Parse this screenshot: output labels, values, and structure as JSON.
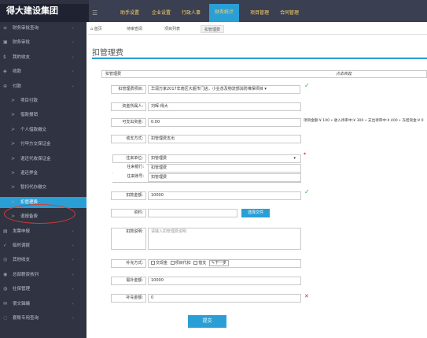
{
  "brand": "得大建设集团",
  "topnav": [
    "助手设置",
    "企业设置",
    "行政人事",
    "财务统计",
    "项目管理",
    "合同管理"
  ],
  "sidebar": [
    {
      "icon": "≡",
      "label": "财务审批查询"
    },
    {
      "icon": "▣",
      "label": "财务审批"
    },
    {
      "icon": "$",
      "label": "我的收支"
    },
    {
      "icon": "◈",
      "label": "收款"
    },
    {
      "icon": "⊕",
      "label": "付款"
    },
    {
      "icon": ">",
      "label": "项目付款",
      "sub": true
    },
    {
      "icon": ">",
      "label": "借款报销",
      "sub": true
    },
    {
      "icon": ">",
      "label": "个人借款缴交",
      "sub": true
    },
    {
      "icon": ">",
      "label": "付甲方交保证金",
      "sub": true
    },
    {
      "icon": ">",
      "label": "退还代收保证金",
      "sub": true
    },
    {
      "icon": ">",
      "label": "退还押金",
      "sub": true
    },
    {
      "icon": ">",
      "label": "暂扣代办缴交",
      "sub": true
    },
    {
      "icon": ">",
      "label": "扣管理费",
      "sub": true,
      "active": true
    },
    {
      "icon": ">",
      "label": "退报备费",
      "sub": true
    },
    {
      "icon": "▤",
      "label": "发票申报"
    },
    {
      "icon": "✓",
      "label": "临时调拨"
    },
    {
      "icon": "◎",
      "label": "其他收支"
    },
    {
      "icon": "◉",
      "label": "总部薪资核列"
    },
    {
      "icon": "◍",
      "label": "社保管理"
    },
    {
      "icon": "✉",
      "label": "很文辑编"
    },
    {
      "icon": "◌",
      "label": "套账专用查询"
    }
  ],
  "tabs": [
    "首页",
    "待审查阅",
    "项目列表",
    "扣管理费"
  ],
  "page_title": "扣管理费",
  "panel": {
    "left": "扣管理费",
    "right": "点击收起"
  },
  "form": {
    "project_label": "扣管理费项目:",
    "project_value": "华润万家2017年南区大超市门店，小业态及物流部消防维保项目 ▾",
    "owner_label": "资金所属人:",
    "owner_value": "刘晖-得大",
    "available_label": "可支出资金:",
    "available_value": "0.00",
    "summary": "项目金额:¥ 100 • 收入待审中:¥ 300 • 支出待审中:¥ 400 • 冻结资金:¥ 0",
    "method_label": "收支方式:",
    "method_value": "扣管理费支出",
    "payee_label": "往来单位:",
    "payee_value": "扣管理费",
    "bank_label": "往来银行:",
    "bank_value": "扣管理费",
    "account_label": "往来账号:",
    "account_value": "扣管理费",
    "amount_label": "扣款金额:",
    "amount_value": "10000",
    "file_label": "资料:",
    "upload_label": "选择文件",
    "desc_label": "扣款说明:",
    "desc_placeholder": "请输入扣管理费说明",
    "supp_label": "补充方式:",
    "opt1": "交现金",
    "opt2": "项目代扣",
    "opt3": "借支",
    "next": "下一步",
    "need_label": "需补金额:",
    "need_value": "10000",
    "paid_label": "补充金额:",
    "paid_value": "0",
    "submit": "提交"
  },
  "colors": {
    "accent": "#2a9fd6",
    "topbar": "#3a3f51",
    "sidebar": "#2f3342",
    "ok": "#3fb04a",
    "err": "#d92626"
  }
}
